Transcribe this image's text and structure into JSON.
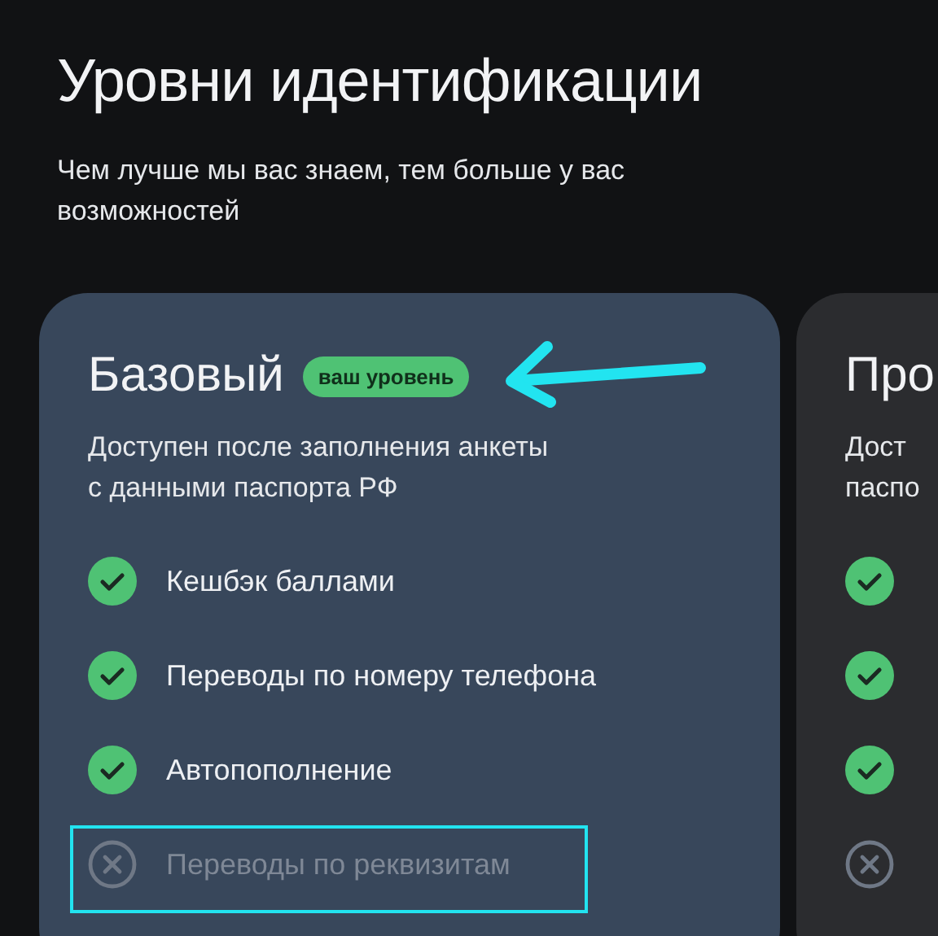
{
  "title": "Уровни идентификации",
  "subtitle": "Чем лучше мы вас знаем, тем больше у вас возможностей",
  "levels": [
    {
      "name": "Базовый",
      "badge": "ваш уровень",
      "description": [
        "Доступен после заполнения анкеты",
        "с данными паспорта РФ"
      ],
      "current": true,
      "features": [
        {
          "text": "Кешбэк баллами",
          "available": true,
          "highlighted": false
        },
        {
          "text": "Переводы по номеру телефона",
          "available": true,
          "highlighted": false
        },
        {
          "text": "Автопополнение",
          "available": true,
          "highlighted": false
        },
        {
          "text": "Переводы по реквизитам",
          "available": false,
          "highlighted": true
        }
      ]
    },
    {
      "name": "Про",
      "description": [
        "Дост",
        "паспо"
      ],
      "current": false,
      "features": [
        {
          "available": true,
          "highlighted": false
        },
        {
          "available": true,
          "highlighted": false
        },
        {
          "available": true,
          "highlighted": false
        },
        {
          "available": false,
          "highlighted": false
        }
      ]
    }
  ]
}
